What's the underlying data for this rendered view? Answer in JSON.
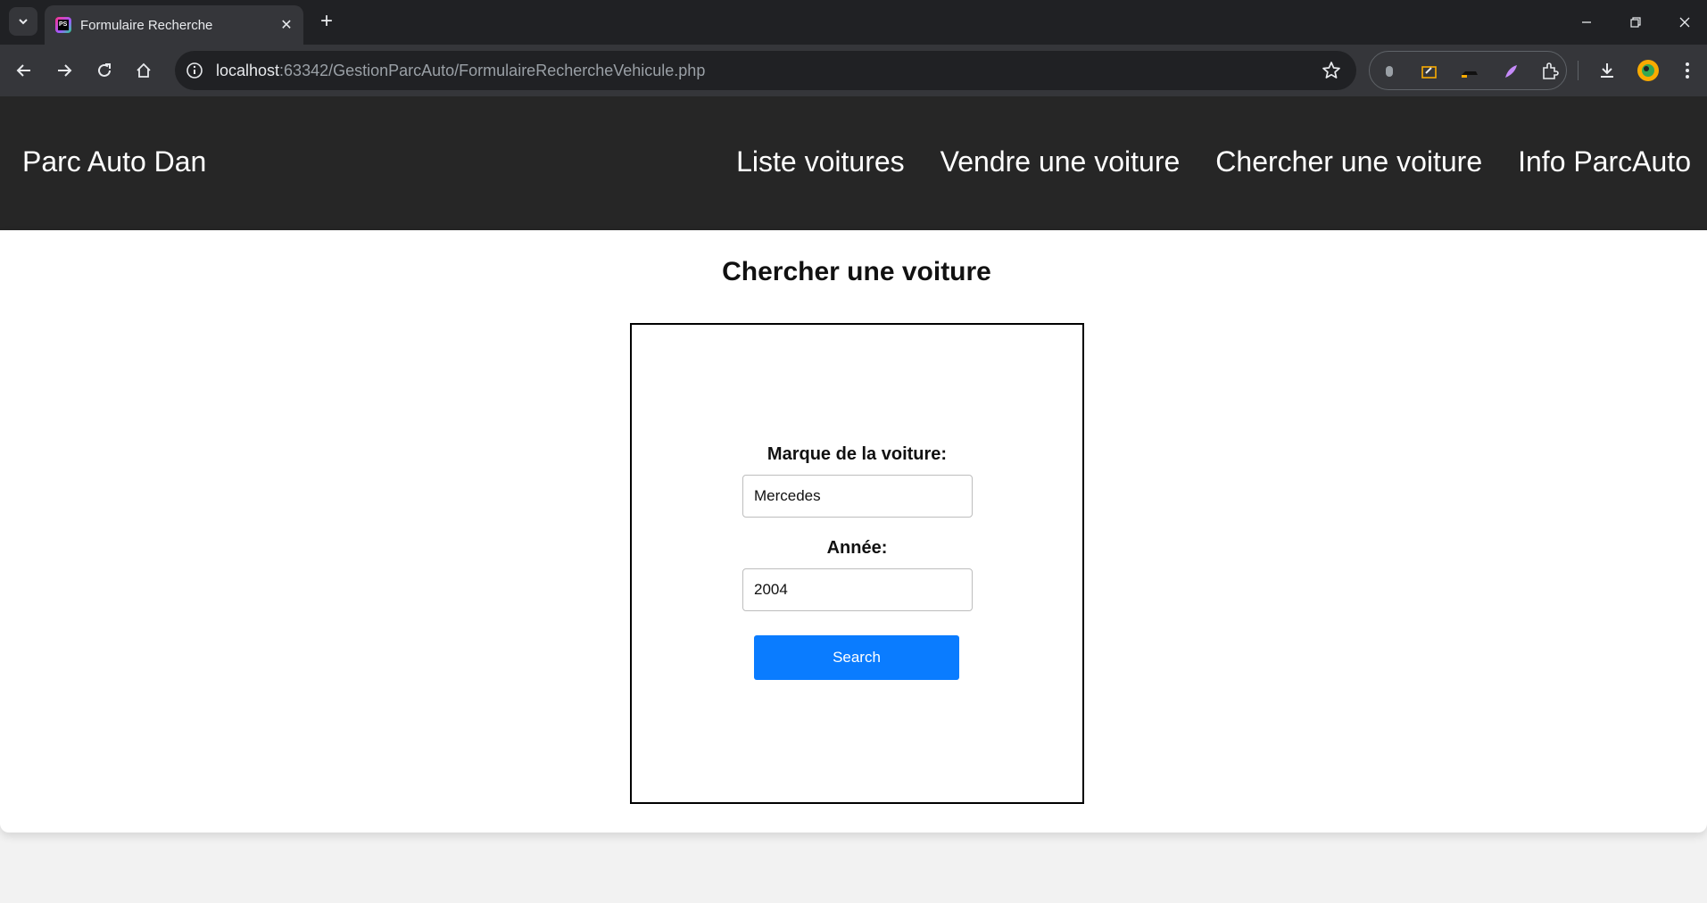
{
  "browser": {
    "tab_title": "Formulaire Recherche",
    "url_host": "localhost",
    "url_path": ":63342/GestionParcAuto/FormulaireRechercheVehicule.php",
    "new_tab_glyph": "+",
    "close_glyph": "✕",
    "icons": [
      "tab-list-icon",
      "back-icon",
      "forward-icon",
      "reload-icon",
      "home-icon",
      "site-info-icon",
      "bookmark-star-icon",
      "extension-icon",
      "download-icon",
      "profile-avatar",
      "menu-icon",
      "minimize-icon",
      "restore-icon",
      "close-window-icon"
    ]
  },
  "site": {
    "brand": "Parc Auto Dan",
    "nav": [
      {
        "label": "Liste voitures"
      },
      {
        "label": "Vendre une voiture"
      },
      {
        "label": "Chercher une voiture"
      },
      {
        "label": "Info ParcAuto"
      }
    ]
  },
  "page": {
    "title": "Chercher une voiture",
    "form": {
      "brand_label": "Marque de la voiture:",
      "brand_value": "Mercedes",
      "year_label": "Année:",
      "year_value": "2004",
      "submit_label": "Search"
    }
  },
  "colors": {
    "header_bg": "#262626",
    "button_bg": "#0a7cff",
    "chrome_dark": "#202124",
    "chrome_toolbar": "#35363a"
  }
}
